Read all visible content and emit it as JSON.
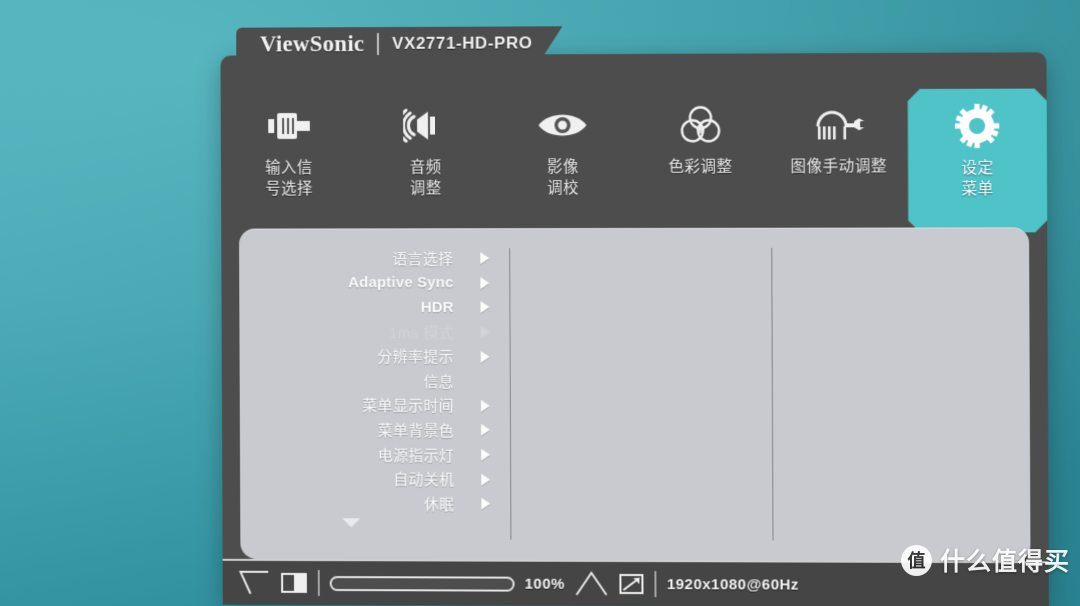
{
  "window": {
    "brand": "ViewSonic",
    "model": "VX2771-HD-PRO"
  },
  "tabs": [
    {
      "label": "输入信\n号选择",
      "icon": "input-connector-icon",
      "active": false
    },
    {
      "label": "音频\n调整",
      "icon": "speaker-icon",
      "active": false
    },
    {
      "label": "影像\n调校",
      "icon": "eye-icon",
      "active": false
    },
    {
      "label": "色彩调整",
      "icon": "color-circles-icon",
      "active": false
    },
    {
      "label": "图像手动调整",
      "icon": "image-wrench-icon",
      "active": false
    },
    {
      "label": "设定\n菜单",
      "icon": "gear-icon",
      "active": true
    }
  ],
  "menu": {
    "items": [
      {
        "label": "语言选择",
        "arrow": true,
        "disabled": false,
        "latin": false
      },
      {
        "label": "Adaptive Sync",
        "arrow": true,
        "disabled": false,
        "latin": true
      },
      {
        "label": "HDR",
        "arrow": true,
        "disabled": false,
        "latin": true
      },
      {
        "label": "1ms 模式",
        "arrow": true,
        "disabled": true,
        "latin": false
      },
      {
        "label": "分辨率提示",
        "arrow": true,
        "disabled": false,
        "latin": false
      },
      {
        "label": "信息",
        "arrow": false,
        "disabled": false,
        "latin": false
      },
      {
        "label": "菜单显示时间",
        "arrow": true,
        "disabled": false,
        "latin": false
      },
      {
        "label": "菜单背景色",
        "arrow": true,
        "disabled": false,
        "latin": false
      },
      {
        "label": "电源指示灯",
        "arrow": true,
        "disabled": false,
        "latin": false
      },
      {
        "label": "自动关机",
        "arrow": true,
        "disabled": false,
        "latin": false
      },
      {
        "label": "休眠",
        "arrow": true,
        "disabled": false,
        "latin": false
      }
    ],
    "scroll_more": true
  },
  "statusbar": {
    "contrast_icon": "contrast-icon",
    "slider_value": 100,
    "slider_text": "100%",
    "brightness_icon": "brightness-icon",
    "resolution": "1920x1080@60Hz"
  },
  "watermark": {
    "badge": "值",
    "text": "什么值得买"
  },
  "colors": {
    "backdrop_teal": "#46aab6",
    "osd_dark": "#4d4d4d",
    "content_grey": "#c9cad0",
    "accent_teal": "#4ec3c8",
    "text_light": "#f2f2f2"
  }
}
